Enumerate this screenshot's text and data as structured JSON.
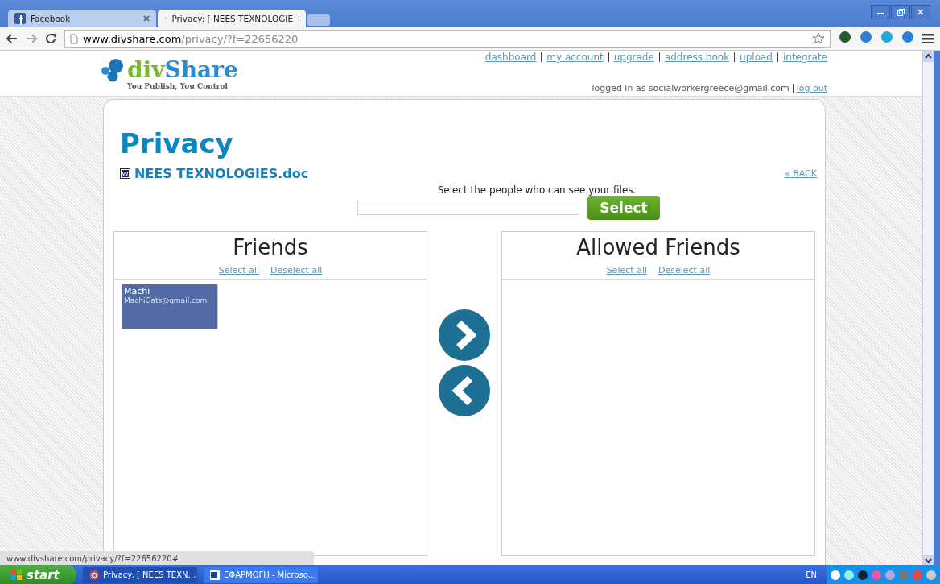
{
  "browser": {
    "tabs": [
      {
        "title": "Facebook",
        "selected": false
      },
      {
        "title": "Privacy: [ NEES TEXNOLOGIE",
        "selected": true
      }
    ],
    "address": {
      "domain": "www.divshare.com",
      "path": "/privacy/?f=22656220"
    }
  },
  "site": {
    "logo": {
      "part1": "div",
      "part2": "Share",
      "tagline": "You Publish, You Control"
    },
    "nav": [
      "dashboard",
      "my account",
      "upgrade",
      "address book",
      "upload",
      "integrate"
    ],
    "login_text": "logged in as socialworkergreece@gmail.com",
    "logout": "log out"
  },
  "page": {
    "title": "Privacy",
    "file": "NEES TEXNOLOGIES.doc",
    "back": "« BACK",
    "instruction": "Select the people who can see your files.",
    "select_button": "Select",
    "panels": [
      {
        "title": "Friends",
        "select_all": "Select all",
        "deselect_all": "Deselect all",
        "items": [
          {
            "name": "Machi",
            "email": "MachiGats@gmail.com",
            "selected": true
          }
        ]
      },
      {
        "title": "Allowed Friends",
        "select_all": "Select all",
        "deselect_all": "Deselect all"
      }
    ]
  },
  "status_bar": "www.divshare.com/privacy/?f=22656220#",
  "taskbar": {
    "start": "start",
    "tasks": [
      {
        "title": "Privacy: [ NEES TEXN…",
        "kind": "browser",
        "selected": true
      },
      {
        "title": "ΕΦΑΡΜΟΓΗ - Microso…",
        "kind": "word",
        "selected": false
      }
    ],
    "language": "EN"
  }
}
